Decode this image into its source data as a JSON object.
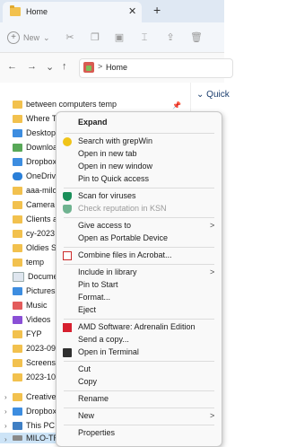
{
  "tab": {
    "title": "Home",
    "close": "✕",
    "new": "+"
  },
  "command_bar": {
    "new_label": "New",
    "new_caret": "⌄"
  },
  "address": {
    "location": "Home",
    "separator": ">"
  },
  "nav_buttons": {
    "back": "←",
    "forward": "→",
    "expand": "⌄",
    "up": "↑"
  },
  "nav_pane": {
    "items": [
      {
        "label": "between computers temp"
      },
      {
        "label": "Where Thi"
      },
      {
        "label": "Desktop"
      },
      {
        "label": "Download"
      },
      {
        "label": "Dropbox"
      },
      {
        "label": "OneDrive"
      },
      {
        "label": "aaa-milo"
      },
      {
        "label": "Camera U"
      },
      {
        "label": "Clients an"
      },
      {
        "label": "cy-2023"
      },
      {
        "label": "Oldies Sca"
      },
      {
        "label": "temp"
      },
      {
        "label": "Documen"
      },
      {
        "label": "Pictures"
      },
      {
        "label": "Music"
      },
      {
        "label": "Videos"
      },
      {
        "label": "FYP"
      },
      {
        "label": "2023-09-2"
      },
      {
        "label": "Screensho"
      },
      {
        "label": "2023-10-0"
      },
      {
        "label": "Creative C"
      },
      {
        "label": "Dropbox"
      },
      {
        "label": "This PC"
      },
      {
        "label": "MILO-TRA"
      }
    ]
  },
  "right_pane": {
    "section": "Quick"
  },
  "context_menu": {
    "items": [
      {
        "label": "Expand"
      },
      {
        "label": "Search with grepWin"
      },
      {
        "label": "Open in new tab"
      },
      {
        "label": "Open in new window"
      },
      {
        "label": "Pin to Quick access"
      },
      {
        "label": "Scan for viruses"
      },
      {
        "label": "Check reputation in KSN"
      },
      {
        "label": "Give access to"
      },
      {
        "label": "Open as Portable Device"
      },
      {
        "label": "Combine files in Acrobat..."
      },
      {
        "label": "Include in library"
      },
      {
        "label": "Pin to Start"
      },
      {
        "label": "Format..."
      },
      {
        "label": "Eject"
      },
      {
        "label": "AMD Software: Adrenalin Edition"
      },
      {
        "label": "Send a copy..."
      },
      {
        "label": "Open in Terminal"
      },
      {
        "label": "Cut"
      },
      {
        "label": "Copy"
      },
      {
        "label": "Rename"
      },
      {
        "label": "New"
      },
      {
        "label": "Properties"
      }
    ],
    "submenu_arrow": ">"
  },
  "colors": {
    "accent": "#0067c0",
    "titlebar": "#dfe8f3",
    "selected": "#cde4f7"
  }
}
